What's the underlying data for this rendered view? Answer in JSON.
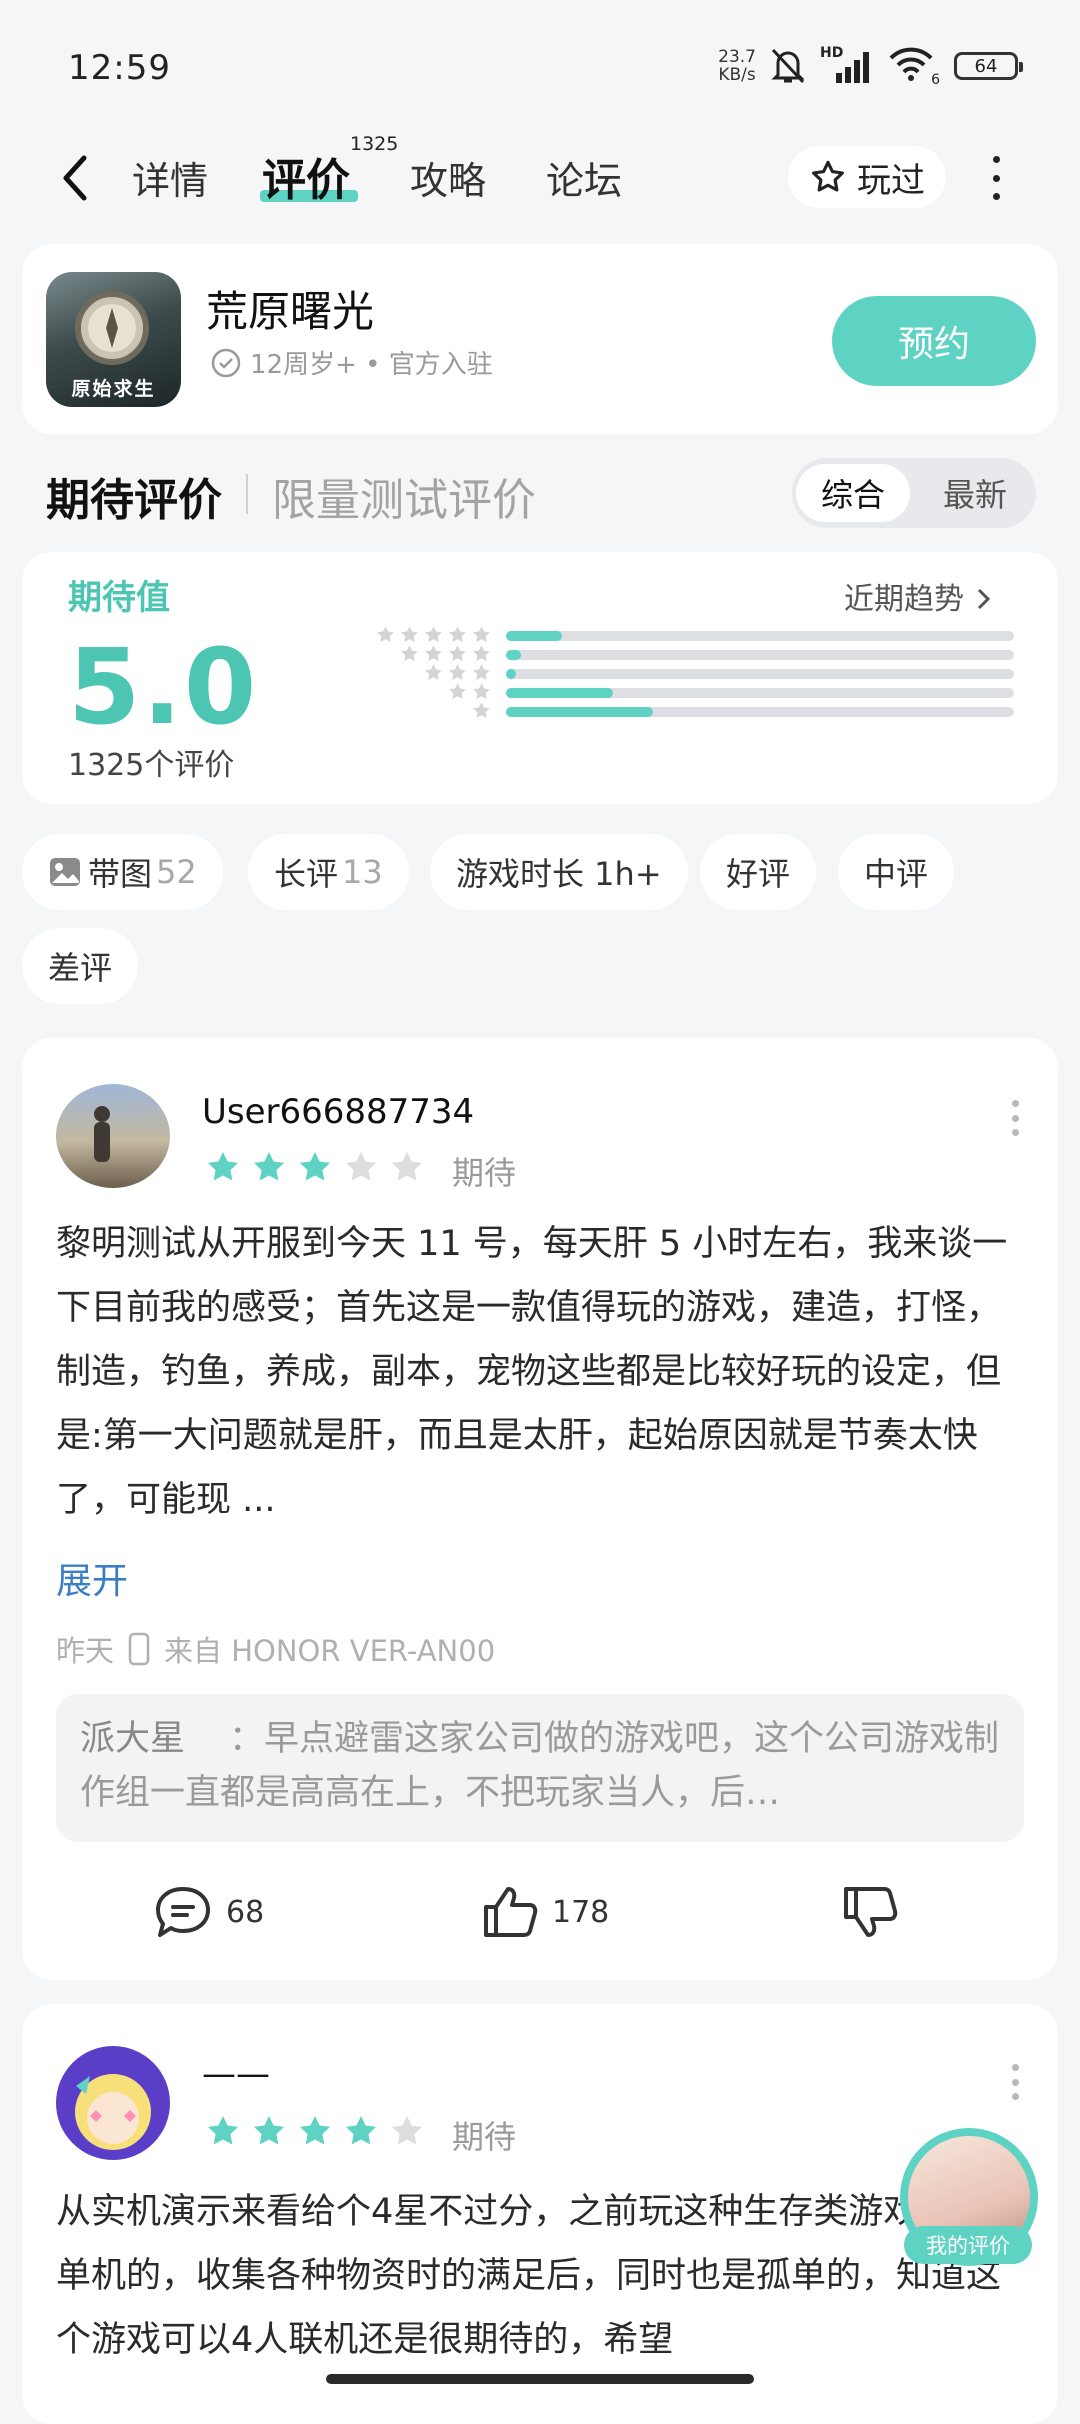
{
  "status_bar": {
    "time": "12:59",
    "net_speed_value": "23.7",
    "net_speed_unit": "KB/s",
    "network_label": "HD",
    "wifi_badge": "6",
    "battery": "64"
  },
  "nav": {
    "tabs": [
      {
        "label": "详情"
      },
      {
        "label": "评价",
        "badge": "1325"
      },
      {
        "label": "攻略"
      },
      {
        "label": "论坛"
      }
    ],
    "played_label": "玩过"
  },
  "game": {
    "title": "荒原曙光",
    "icon_text": "原始求生",
    "meta": "12周岁+ • 官方入驻",
    "reserve_label": "预约"
  },
  "rating_section": {
    "title": "期待评价",
    "subtitle": "限量测试评价",
    "sort_options": [
      "综合",
      "最新"
    ],
    "active_sort": "综合"
  },
  "rating": {
    "label": "期待值",
    "score": "5.0",
    "count_text": "1325个评价",
    "trend_label": "近期趋势",
    "distribution": [
      {
        "stars": 5,
        "fraction": 0.11
      },
      {
        "stars": 4,
        "fraction": 0.03
      },
      {
        "stars": 3,
        "fraction": 0.02
      },
      {
        "stars": 2,
        "fraction": 0.21
      },
      {
        "stars": 1,
        "fraction": 0.29
      }
    ]
  },
  "filters": [
    {
      "label": "带图",
      "count": "52",
      "icon": "image-icon"
    },
    {
      "label": "长评",
      "count": "13"
    },
    {
      "label": "游戏时长 1h+",
      "count": ""
    },
    {
      "label": "好评",
      "count": ""
    },
    {
      "label": "中评",
      "count": ""
    },
    {
      "label": "差评",
      "count": ""
    }
  ],
  "reviews": [
    {
      "username": "User666887734",
      "stars": 3,
      "tag": "期待",
      "text": "黎明测试从开服到今天 11 号，每天肝 5 小时左右，我来谈一下目前我的感受；首先这是一款值得玩的游戏，建造，打怪，制造，钓鱼，养成，副本，宠物这些都是比较好玩的设定，但是:第一大问题就是肝，而且是太肝，起始原因就是节奏太快了，可能现 ...",
      "expand_label": "展开",
      "time": "昨天",
      "device": "来自 HONOR VER-AN00",
      "reply_author": "派大星",
      "reply_text": "：早点避雷这家公司做的游戏吧，这个公司游戏制作组一直都是高高在上，不把玩家当人，后…",
      "comments": "68",
      "likes": "178"
    },
    {
      "username": "——",
      "stars": 4,
      "tag": "期待",
      "text": "从实机演示来看给个4星不过分，之前玩这种生存类游戏都是单机的，收集各种物资时的满足后，同时也是孤单的，知道这个游戏可以4人联机还是很期待的，希望"
    }
  ],
  "my_review_label": "我的评价",
  "colors": {
    "accent": "#5fd3c3",
    "accent_text": "#4cc6b3",
    "link": "#3a7fc6"
  }
}
